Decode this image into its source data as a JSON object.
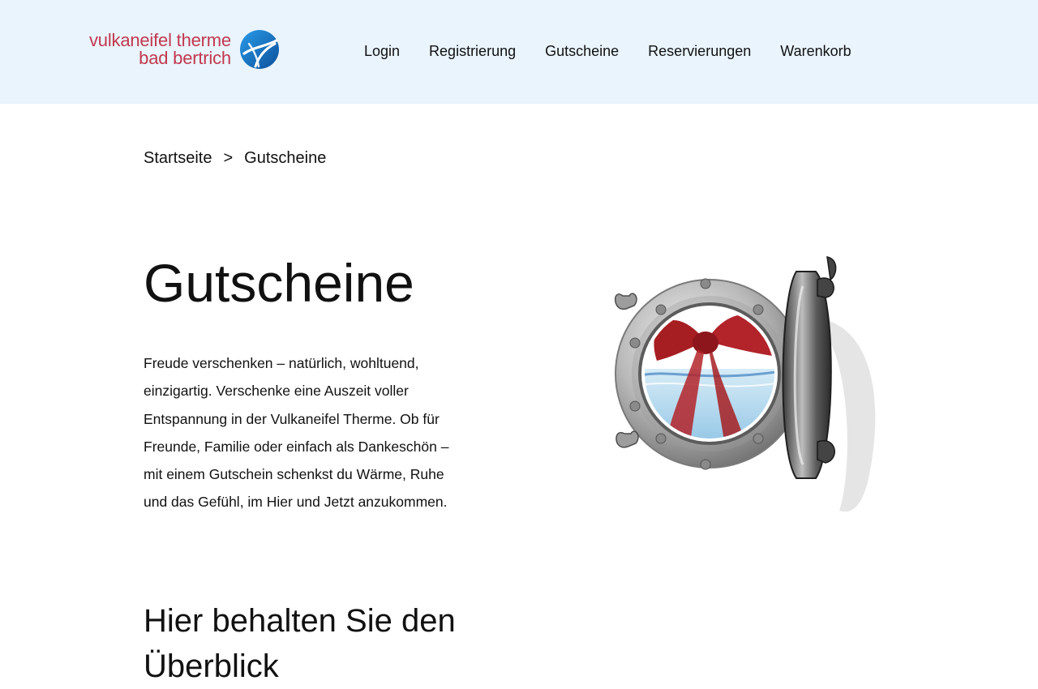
{
  "header": {
    "logo": {
      "line1": "vulkaneifel therme",
      "line2": "bad bertrich"
    },
    "nav": [
      {
        "label": "Login"
      },
      {
        "label": "Registrierung"
      },
      {
        "label": "Gutscheine"
      },
      {
        "label": "Reservierungen"
      },
      {
        "label": "Warenkorb"
      }
    ]
  },
  "breadcrumb": {
    "home": "Startseite",
    "separator": ">",
    "current": "Gutscheine"
  },
  "main": {
    "title": "Gutscheine",
    "intro": "Freude verschenken – natürlich, wohltuend, einzigartig. Verschenke eine Auszeit voller Entspannung in der Vulkaneifel Therme. Ob für Freunde, Familie oder einfach als Dankeschön – mit einem Gutschein schenkst du Wärme, Ruhe und das Gefühl, im Hier und Jetzt anzukommen.",
    "sub_heading": "Hier behalten Sie den Überblick"
  },
  "colors": {
    "header_bg": "#e9f4fd",
    "brand_red": "#c2384d",
    "brand_blue": "#1b7fd0"
  }
}
